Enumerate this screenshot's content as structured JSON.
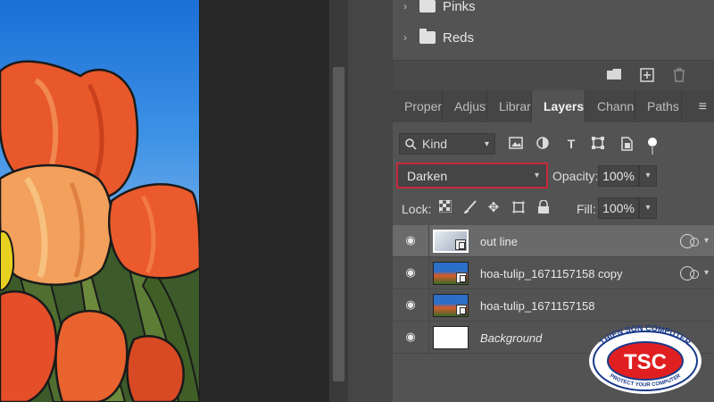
{
  "canvas": {
    "description_icon": "tulip-painting"
  },
  "swatches": {
    "folders": [
      {
        "label": "Pinks"
      },
      {
        "label": "Reds"
      }
    ],
    "tools": [
      "new-folder-icon",
      "new-swatch-icon",
      "trash-icon"
    ]
  },
  "tabs": [
    {
      "label": "Proper",
      "active": false
    },
    {
      "label": "Adjust",
      "active": false
    },
    {
      "label": "Librari",
      "active": false
    },
    {
      "label": "Layers",
      "active": true
    },
    {
      "label": "Channe",
      "active": false
    },
    {
      "label": "Paths",
      "active": false
    }
  ],
  "filter": {
    "kind_label": "Kind",
    "icons": [
      "image-filter-icon",
      "adjustment-filter-icon",
      "type-filter-icon",
      "shape-filter-icon",
      "smart-object-filter-icon",
      "filter-toggle-icon"
    ]
  },
  "blend": {
    "mode": "Darken",
    "opacity_label": "Opacity:",
    "opacity_value": "100%"
  },
  "lock": {
    "label": "Lock:",
    "fill_label": "Fill:",
    "fill_value": "100%",
    "icons": [
      "lock-transparent-icon",
      "lock-image-icon",
      "lock-position-icon",
      "lock-artboard-icon",
      "lock-all-icon"
    ]
  },
  "layers": [
    {
      "name": "out line",
      "thumb": "sketch",
      "smart": true,
      "selected": true,
      "link": true,
      "italic": false
    },
    {
      "name": "hoa-tulip_1671157158 copy",
      "thumb": "photo",
      "smart": true,
      "selected": false,
      "link": true,
      "italic": false
    },
    {
      "name": "hoa-tulip_1671157158",
      "thumb": "photo",
      "smart": true,
      "selected": false,
      "link": false,
      "italic": false
    },
    {
      "name": "Background",
      "thumb": "white",
      "smart": false,
      "selected": false,
      "link": false,
      "italic": true
    }
  ],
  "logo": {
    "top_text": "THIEN SON COMPUTER",
    "center_text": "TSC",
    "bottom_text": "PROTECT YOUR COMPUTER"
  }
}
